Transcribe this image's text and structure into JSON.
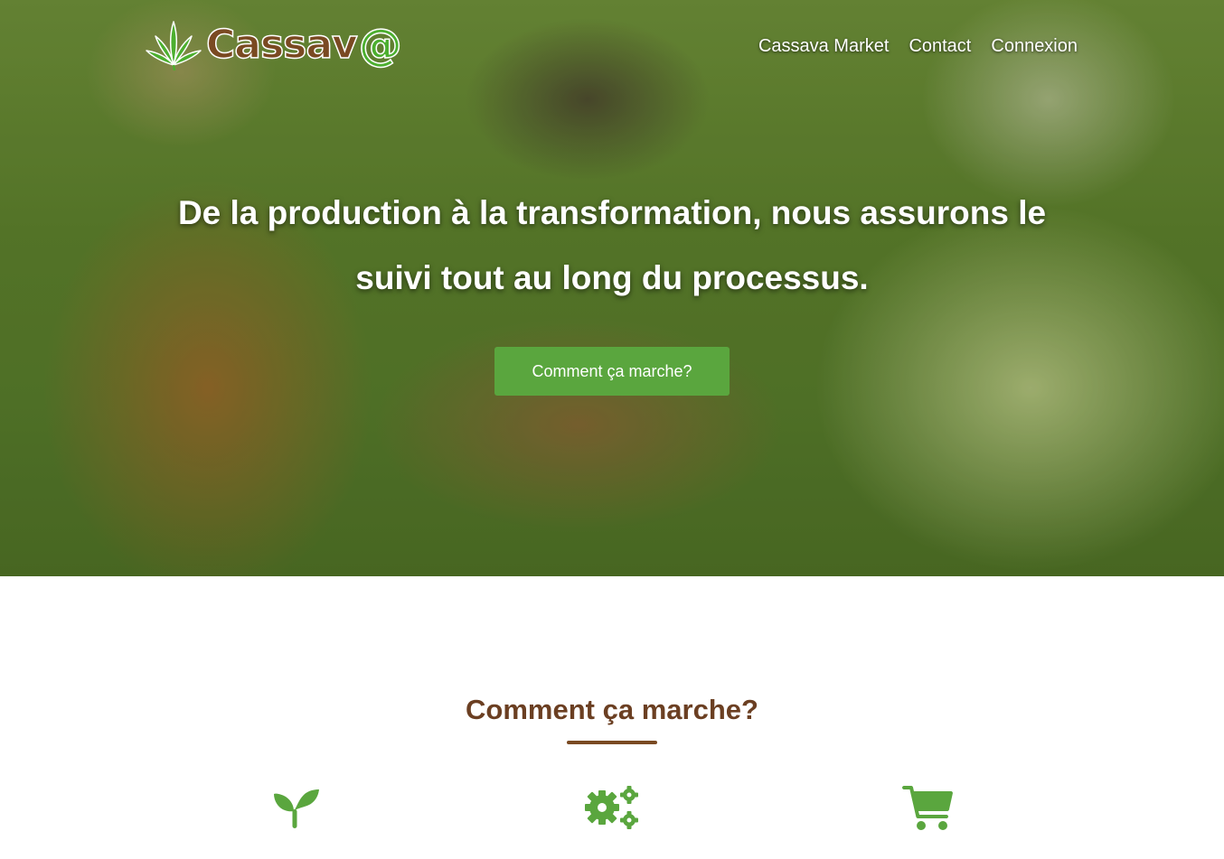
{
  "brand": {
    "name": "Cassav",
    "at_symbol": "@",
    "logo_icon": "cassava-leaf-icon",
    "brown": "#7a4a22",
    "green": "#4caf2f"
  },
  "nav": {
    "links": [
      {
        "label": "Cassava Market"
      },
      {
        "label": "Contact"
      },
      {
        "label": "Connexion"
      }
    ]
  },
  "hero": {
    "title_line1": "De la production à la transformation, nous assurons le",
    "title_line2": "suivi tout au long du processus.",
    "button_label": "Comment ça marche?",
    "button_color": "#5aa63e"
  },
  "how_it_works": {
    "title": "Comment ça marche?",
    "title_color": "#6b3f22",
    "accent_color": "#5aa63e",
    "steps": [
      {
        "icon": "seedling-icon"
      },
      {
        "icon": "gears-icon"
      },
      {
        "icon": "shopping-cart-icon"
      }
    ]
  }
}
